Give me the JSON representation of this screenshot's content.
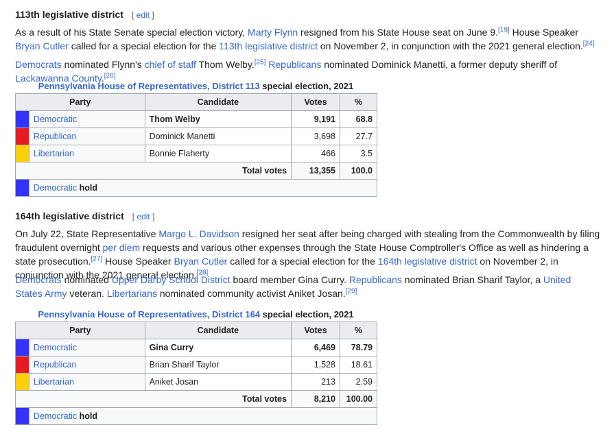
{
  "sections": [
    {
      "heading": "113th legislative district",
      "edit": "edit",
      "para1": [
        {
          "t": "As a result of his State Senate special election victory, "
        },
        {
          "t": "Marty Flynn",
          "link": true
        },
        {
          "t": " resigned from his State House seat on June 9."
        },
        {
          "t": "[19]",
          "sup": true
        },
        {
          "t": " House Speaker "
        },
        {
          "t": "Bryan Cutler",
          "link": true
        },
        {
          "t": " called for a special election for the "
        },
        {
          "t": "113th legislative district",
          "link": true
        },
        {
          "t": " on November 2, in conjunction with the 2021 general election."
        },
        {
          "t": "[24]",
          "sup": true
        }
      ],
      "para2": [
        {
          "t": "Democrats",
          "link": true
        },
        {
          "t": " nominated Flynn's "
        },
        {
          "t": "chief of staff",
          "link": true
        },
        {
          "t": " Thom Welby."
        },
        {
          "t": "[25]",
          "sup": true
        },
        {
          "t": " "
        },
        {
          "t": "Republicans",
          "link": true
        },
        {
          "t": " nominated Dominick Manetti, a former deputy sheriff of "
        },
        {
          "t": "Lackawanna County",
          "link": true
        },
        {
          "t": "."
        },
        {
          "t": "[26]",
          "sup": true
        }
      ],
      "caption_link": "Pennsylvania House of Representatives, District 113",
      "caption_rest": " special election, 2021",
      "headers": [
        "Party",
        "Candidate",
        "Votes",
        "%"
      ],
      "rows": [
        {
          "party": "Democratic",
          "candidate": "Thom Welby",
          "votes": "9,191",
          "pct": "68.8",
          "color": "#3333ff",
          "winner": true
        },
        {
          "party": "Republican",
          "candidate": "Dominick Manetti",
          "votes": "3,698",
          "pct": "27.7",
          "color": "#e81b23",
          "winner": false
        },
        {
          "party": "Libertarian",
          "candidate": "Bonnie Flaherty",
          "votes": "466",
          "pct": "3.5",
          "color": "#fed105",
          "winner": false
        }
      ],
      "total_label": "Total votes",
      "total_votes": "13,355",
      "total_pct": "100.0",
      "hold_party": "Democratic",
      "hold_word": "hold",
      "hold_color": "#3333ff"
    },
    {
      "heading": "164th legislative district",
      "edit": "edit",
      "para1": [
        {
          "t": "On July 22, State Representative "
        },
        {
          "t": "Margo L. Davidson",
          "link": true
        },
        {
          "t": " resigned her seat after being charged with stealing from the Commonwealth by filing fraudulent overnight "
        },
        {
          "t": "per diem",
          "link": true
        },
        {
          "t": " requests and various other expenses through the State House Comptroller's Office as well as hindering a state prosecution."
        },
        {
          "t": "[27]",
          "sup": true
        },
        {
          "t": " House Speaker "
        },
        {
          "t": "Bryan Cutler",
          "link": true
        },
        {
          "t": " called for a special election for the "
        },
        {
          "t": "164th legislative district",
          "link": true
        },
        {
          "t": " on November 2, in conjunction with the 2021 general election."
        },
        {
          "t": "[28]",
          "sup": true
        }
      ],
      "para2": [
        {
          "t": "Democrats",
          "link": true
        },
        {
          "t": " nominated "
        },
        {
          "t": "Upper Darby School District",
          "link": true
        },
        {
          "t": " board member Gina Curry. "
        },
        {
          "t": "Republicans",
          "link": true
        },
        {
          "t": " nominated Brian Sharif Taylor, a "
        },
        {
          "t": "United States Army",
          "link": true
        },
        {
          "t": " veteran. "
        },
        {
          "t": "Libertarians",
          "link": true
        },
        {
          "t": " nominated community activist Aniket Josan."
        },
        {
          "t": "[29]",
          "sup": true
        }
      ],
      "caption_link": "Pennsylvania House of Representatives, District 164",
      "caption_rest": " special election, 2021",
      "headers": [
        "Party",
        "Candidate",
        "Votes",
        "%"
      ],
      "rows": [
        {
          "party": "Democratic",
          "candidate": "Gina Curry",
          "votes": "6,469",
          "pct": "78.79",
          "color": "#3333ff",
          "winner": true
        },
        {
          "party": "Republican",
          "candidate": "Brian Sharif Taylor",
          "votes": "1,528",
          "pct": "18.61",
          "color": "#e81b23",
          "winner": false
        },
        {
          "party": "Libertarian",
          "candidate": "Aniket Josan",
          "votes": "213",
          "pct": "2.59",
          "color": "#fed105",
          "winner": false
        }
      ],
      "total_label": "Total votes",
      "total_votes": "8,210",
      "total_pct": "100.00",
      "hold_party": "Democratic",
      "hold_word": "hold",
      "hold_color": "#3333ff"
    }
  ]
}
